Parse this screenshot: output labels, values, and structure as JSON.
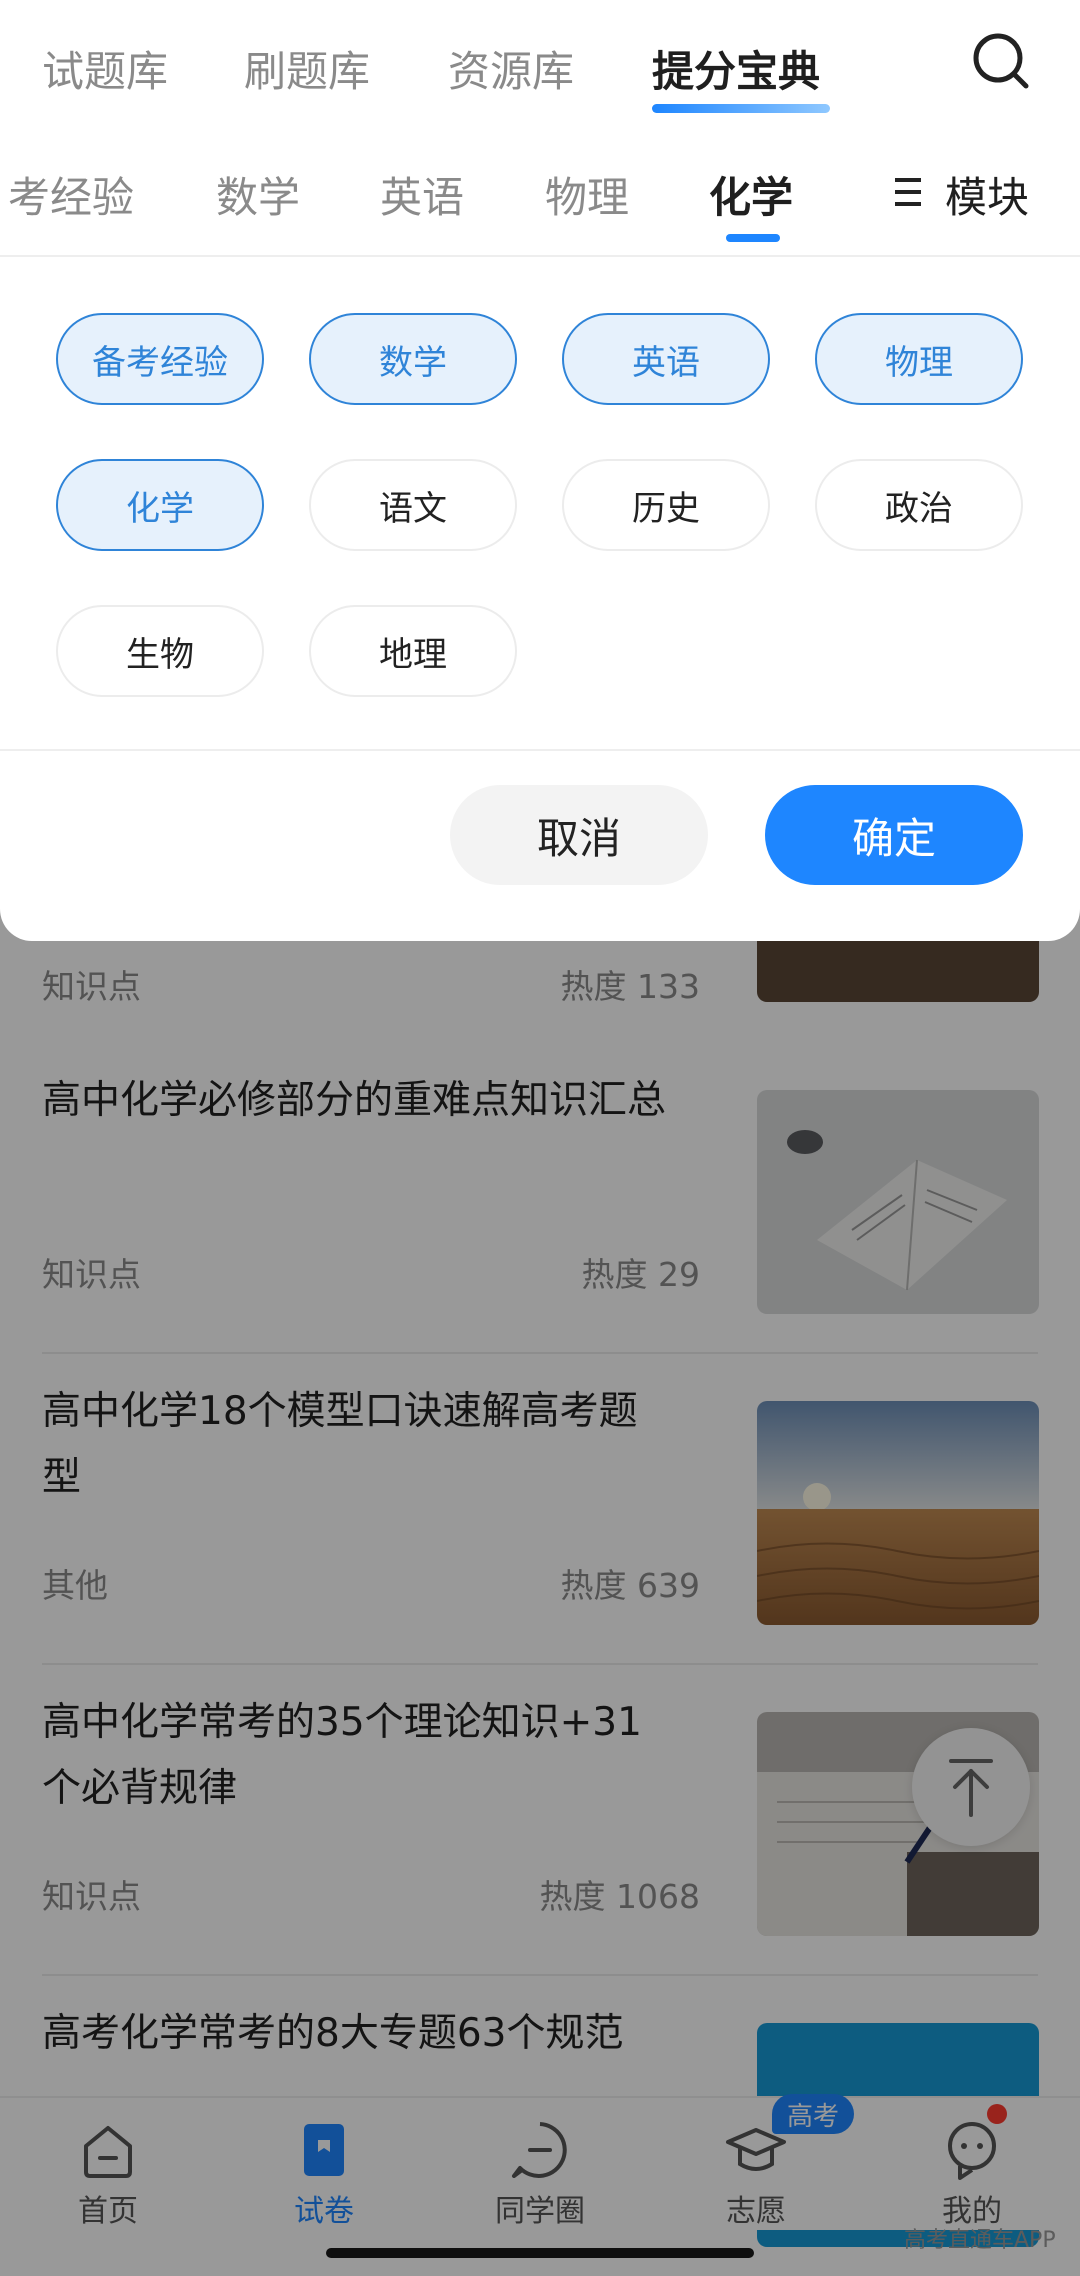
{
  "top_tabs": [
    {
      "label": "试题库",
      "active": false
    },
    {
      "label": "刷题库",
      "active": false
    },
    {
      "label": "资源库",
      "active": false
    },
    {
      "label": "提分宝典",
      "active": true
    }
  ],
  "search_icon": "search-icon",
  "subject_tabs": [
    {
      "label": "考经验",
      "active": false
    },
    {
      "label": "数学",
      "active": false
    },
    {
      "label": "英语",
      "active": false
    },
    {
      "label": "物理",
      "active": false
    },
    {
      "label": "化学",
      "active": true
    }
  ],
  "module_button": {
    "label": "模块",
    "icon": "menu-icon"
  },
  "filter_panel": {
    "chips": [
      {
        "label": "备考经验",
        "selected": true
      },
      {
        "label": "数学",
        "selected": true
      },
      {
        "label": "英语",
        "selected": true
      },
      {
        "label": "物理",
        "selected": true
      },
      {
        "label": "化学",
        "selected": true
      },
      {
        "label": "语文",
        "selected": false
      },
      {
        "label": "历史",
        "selected": false
      },
      {
        "label": "政治",
        "selected": false
      },
      {
        "label": "生物",
        "selected": false
      },
      {
        "label": "地理",
        "selected": false
      }
    ],
    "cancel_label": "取消",
    "confirm_label": "确定"
  },
  "articles_fragment": {
    "category": "知识点",
    "heat": "热度 133"
  },
  "articles": [
    {
      "title": "高中化学必修部分的重难点知识汇总",
      "category": "知识点",
      "heat": "热度 29"
    },
    {
      "title": "高中化学18个模型口诀速解高考题型",
      "category": "其他",
      "heat": "热度 639"
    },
    {
      "title": "高中化学常考的35个理论知识+31个必背规律",
      "category": "知识点",
      "heat": "热度 1068"
    },
    {
      "title": "高考化学常考的8大专题63个规范",
      "category": "",
      "heat": ""
    }
  ],
  "bottom_nav": [
    {
      "label": "首页",
      "icon": "home-icon",
      "active": false
    },
    {
      "label": "试卷",
      "icon": "exam-paper-icon",
      "active": true
    },
    {
      "label": "同学圈",
      "icon": "chat-circle-icon",
      "active": false
    },
    {
      "label": "志愿",
      "icon": "graduation-cap-icon",
      "active": false
    },
    {
      "label": "我的",
      "icon": "profile-icon",
      "active": false
    }
  ],
  "gaokao_badge": "高考",
  "watermark": "高考直通车APP",
  "colors": {
    "accent": "#1e86ff",
    "chip_selected": "#2f84d8",
    "chip_selected_bg": "#e6f1fc"
  }
}
